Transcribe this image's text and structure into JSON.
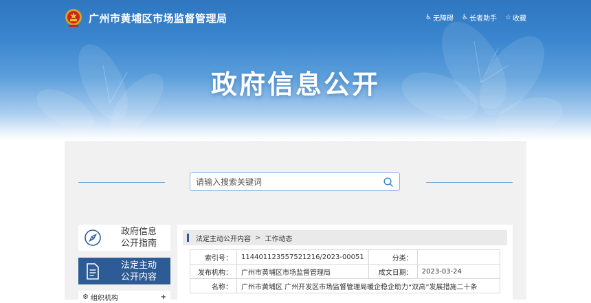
{
  "header": {
    "site_title": "广州市黄埔区市场监督管理局",
    "utility": [
      {
        "label": "无障碍",
        "icon": "accessibility-icon"
      },
      {
        "label": "长者助手",
        "icon": "elder-assist-icon"
      },
      {
        "label": "收藏",
        "icon": "star-icon"
      }
    ]
  },
  "hero": {
    "heading": "政府信息公开"
  },
  "search": {
    "placeholder": "请输入搜索关键词"
  },
  "sidebar": {
    "guide_label_1": "政府信息",
    "guide_label_2": "公开指南",
    "active_label_1": "法定主动",
    "active_label_2": "公开内容",
    "item_label": "组织机构"
  },
  "breadcrumb": {
    "level1": "法定主动公开内容",
    "separator": ">",
    "level2": "工作动态"
  },
  "meta": {
    "index_key": "索引号：",
    "index_value": "114401123557521216/2023-00051",
    "category_key": "分类：",
    "category_value": "",
    "publisher_key": "发布机构：",
    "publisher_value": "广州市黄埔区市场监督管理局",
    "date_key": "成文日期：",
    "date_value": "2023-03-24",
    "name_key": "名称：",
    "name_value": "广州市黄埔区 广州开发区市场监督管理局暖企稳企助力“双高”发展措施二十条"
  },
  "colors": {
    "brand_blue": "#2d5b96",
    "hero_blue": "#3a86cf",
    "panel_bg": "#f1f1f1"
  }
}
